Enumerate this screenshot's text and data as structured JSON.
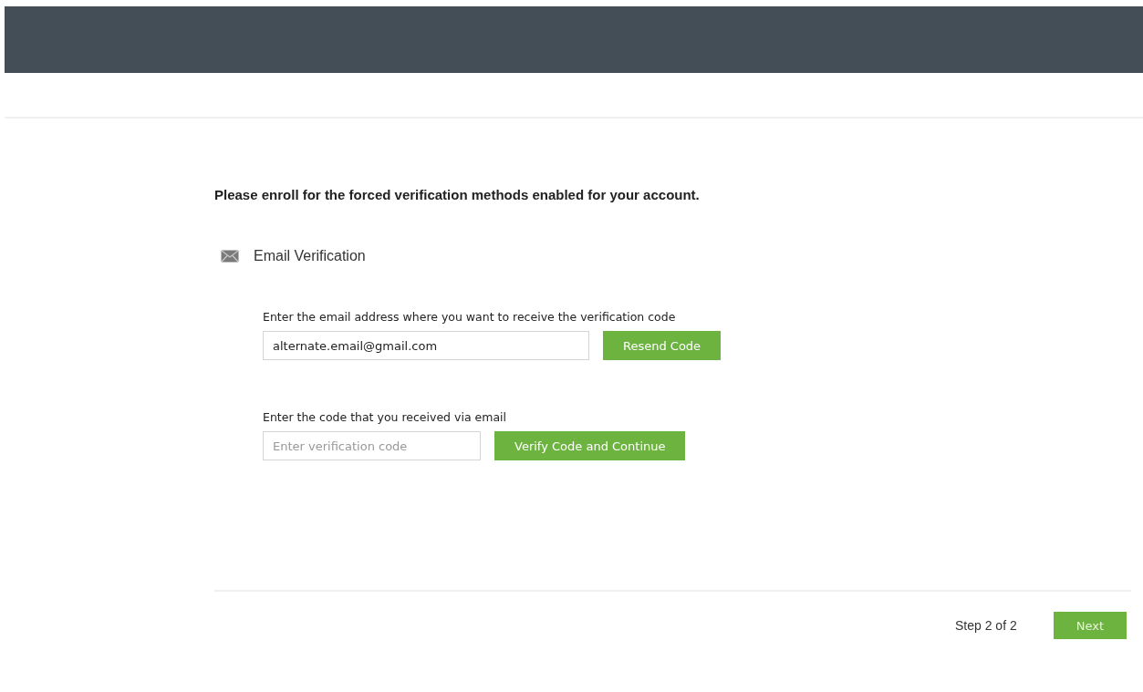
{
  "heading": "Please enroll for the forced verification methods enabled for your account.",
  "method": {
    "title": "Email Verification"
  },
  "email_section": {
    "label": "Enter the email address where you want to receive the verification code",
    "value": "alternate.email@gmail.com",
    "button": "Resend Code"
  },
  "code_section": {
    "label": "Enter the code that you received via email",
    "placeholder": "Enter verification code",
    "button": "Verify Code and Continue"
  },
  "footer": {
    "step": "Step 2 of 2",
    "button": "Next"
  }
}
